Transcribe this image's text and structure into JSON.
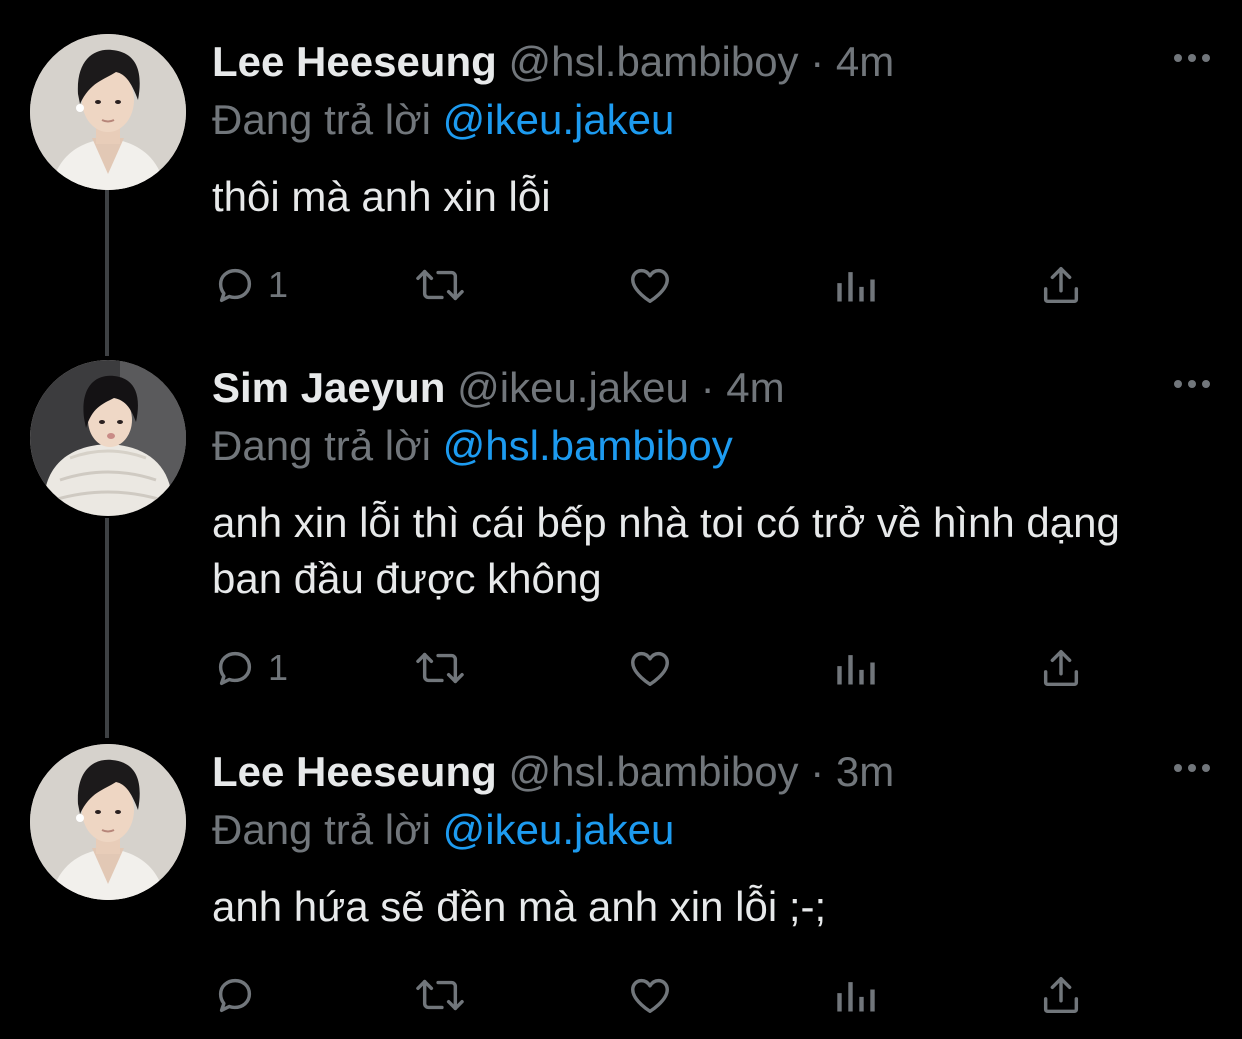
{
  "tweets": [
    {
      "name": "Lee Heeseung",
      "handle": "@hsl.bambiboy",
      "separator": "·",
      "time": "4m",
      "replying_label": "Đang trả lời",
      "replying_to": "@ikeu.jakeu",
      "text": "thôi mà anh xin lỗi",
      "reply_count": "1",
      "avatar": "man-portrait-white-shirt"
    },
    {
      "name": "Sim Jaeyun",
      "handle": "@ikeu.jakeu",
      "separator": "·",
      "time": "4m",
      "replying_label": "Đang trả lời",
      "replying_to": "@hsl.bambiboy",
      "text": "anh xin lỗi thì cái bếp nhà toi có trở về hình dạng ban đầu được không",
      "reply_count": "1",
      "avatar": "man-portrait-puffer-jacket"
    },
    {
      "name": "Lee Heeseung",
      "handle": "@hsl.bambiboy",
      "separator": "·",
      "time": "3m",
      "replying_label": "Đang trả lời",
      "replying_to": "@ikeu.jakeu",
      "text": "anh hứa sẽ đền mà anh xin lỗi ;-;",
      "reply_count": "",
      "avatar": "man-portrait-white-shirt"
    }
  ],
  "icons": {
    "reply": "speech-bubble-icon",
    "retweet": "retweet-arrows-icon",
    "like": "heart-icon",
    "analytics": "bar-chart-icon",
    "share": "upload-arrow-icon",
    "more": "ellipsis-icon"
  },
  "colors": {
    "background": "#000000",
    "text": "#e7e9ea",
    "muted": "#71767b",
    "accent": "#1d9bf0",
    "thread_line": "#3e4144"
  }
}
